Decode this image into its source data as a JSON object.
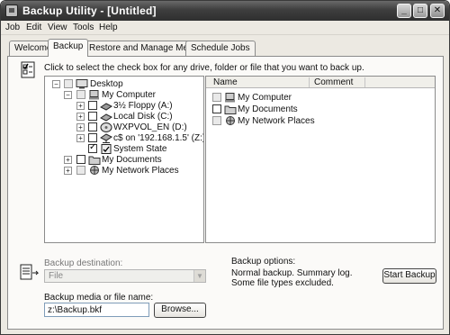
{
  "window": {
    "title": "Backup Utility - [Untitled]"
  },
  "menu": [
    "Job",
    "Edit",
    "View",
    "Tools",
    "Help"
  ],
  "tabs": [
    {
      "label": "Welcome",
      "active": false
    },
    {
      "label": "Backup",
      "active": true
    },
    {
      "label": "Restore and Manage Media",
      "active": false
    },
    {
      "label": "Schedule Jobs",
      "active": false
    }
  ],
  "backup": {
    "instruction": "Click to select the check box for any drive, folder or file that you want to back up.",
    "tree": [
      {
        "label": "Desktop",
        "expander": "−",
        "icon": "desktop-icon"
      },
      {
        "label": "My Computer",
        "expander": "−",
        "icon": "computer-icon"
      },
      {
        "label": "3½ Floppy (A:)",
        "expander": "+",
        "icon": "floppy-icon"
      },
      {
        "label": "Local Disk (C:)",
        "expander": "+",
        "icon": "disk-icon"
      },
      {
        "label": "WXPVOL_EN (D:)",
        "expander": "+",
        "icon": "cd-icon"
      },
      {
        "label": "c$ on '192.168.1.5' (Z:)",
        "expander": "+",
        "icon": "network-drive-icon"
      },
      {
        "label": "System State",
        "expander": "",
        "icon": "system-state-icon"
      },
      {
        "label": "My Documents",
        "expander": "+",
        "icon": "folder-icon"
      },
      {
        "label": "My Network Places",
        "expander": "+",
        "icon": "network-icon"
      }
    ],
    "list_columns": [
      "Name",
      "Comment"
    ],
    "list": [
      {
        "label": "My Computer",
        "icon": "computer-icon"
      },
      {
        "label": "My Documents",
        "icon": "folder-icon"
      },
      {
        "label": "My Network Places",
        "icon": "network-icon"
      }
    ],
    "destination_label": "Backup destination:",
    "destination_value": "File",
    "media_label": "Backup media or file name:",
    "media_value": "z:\\Backup.bkf",
    "browse_label": "Browse...",
    "options_title": "Backup options:",
    "options_lines": [
      "Normal backup.  Summary log.",
      "Some file types excluded."
    ],
    "start_label": "Start Backup"
  }
}
